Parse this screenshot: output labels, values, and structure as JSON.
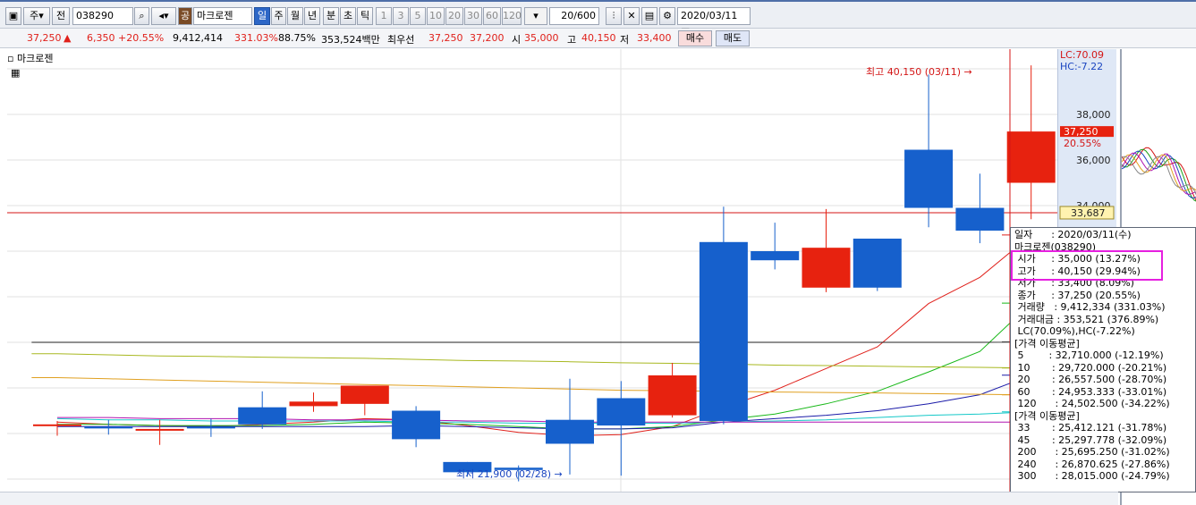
{
  "toolbar": {
    "market": "주",
    "scope": "전",
    "code": "038290",
    "name_badge": "공",
    "name": "마크로젠",
    "periods": [
      "일",
      "주",
      "월",
      "년",
      "분",
      "초",
      "틱"
    ],
    "minutes": [
      "1",
      "3",
      "5",
      "10",
      "20",
      "30",
      "60",
      "120"
    ],
    "count": "20/600",
    "date": "2020/03/11"
  },
  "quote": {
    "price": "37,250",
    "change": "6,350",
    "change_pct": "+20.55%",
    "volume": "9,412,414",
    "volume_ratio": "331.03%",
    "turnover": "88.75%",
    "amount": "353,524백만",
    "best_label": "최우선",
    "best_ask": "37,250",
    "best_bid": "37,200",
    "open_label": "시",
    "open": "35,000",
    "high_label": "고",
    "high": "40,150",
    "low_label": "저",
    "low": "33,400",
    "buy_label": "매수",
    "sell_label": "매도"
  },
  "chart": {
    "title": "마크로젠",
    "high_annotation": "최고 40,150 (03/11)",
    "low_annotation": "최저 21,900 (02/28)",
    "lc_label": "LC:70.09",
    "hc_label": "HC:-7.22",
    "price_tag": "37,250",
    "pct_tag": "20.55%",
    "line_tag": "33,687",
    "axis_labels": [
      "38,000",
      "36,000",
      "34,000"
    ]
  },
  "chart_data": {
    "type": "candlestick",
    "title": "마크로젠",
    "y_ticks": [
      34000,
      36000,
      38000
    ],
    "y_range": [
      20000,
      40350
    ],
    "candles": [
      {
        "o": 24350,
        "h": 24550,
        "l": 23900,
        "c": 24400
      },
      {
        "o": 24300,
        "h": 24600,
        "l": 23950,
        "c": 24250
      },
      {
        "o": 24200,
        "h": 24600,
        "l": 23500,
        "c": 24200
      },
      {
        "o": 24300,
        "h": 24650,
        "l": 23850,
        "c": 24250
      },
      {
        "o": 25150,
        "h": 25850,
        "l": 24200,
        "c": 24400
      },
      {
        "o": 25200,
        "h": 25800,
        "l": 24950,
        "c": 25400
      },
      {
        "o": 25300,
        "h": 26000,
        "l": 24800,
        "c": 26100
      },
      {
        "o": 25000,
        "h": 25200,
        "l": 23400,
        "c": 23750
      },
      {
        "o": 22750,
        "h": 22750,
        "l": 22100,
        "c": 22300
      },
      {
        "o": 22500,
        "h": 22600,
        "l": 21900,
        "c": 22400
      },
      {
        "o": 24600,
        "h": 26400,
        "l": 22200,
        "c": 23550
      },
      {
        "o": 25550,
        "h": 26300,
        "l": 22150,
        "c": 24350
      },
      {
        "o": 24800,
        "h": 27100,
        "l": 24700,
        "c": 26550
      },
      {
        "o": 32400,
        "h": 33950,
        "l": 24400,
        "c": 24550
      },
      {
        "o": 32000,
        "h": 33250,
        "l": 31200,
        "c": 31600
      },
      {
        "o": 30400,
        "h": 33850,
        "l": 30200,
        "c": 32150
      },
      {
        "o": 32550,
        "h": 32550,
        "l": 30250,
        "c": 30400
      },
      {
        "o": 36450,
        "h": 39750,
        "l": 33050,
        "c": 33900
      },
      {
        "o": 33900,
        "h": 35400,
        "l": 32350,
        "c": 32900
      },
      {
        "o": 35000,
        "h": 40150,
        "l": 33400,
        "c": 37250
      }
    ],
    "moving_averages": [
      {
        "name": "5",
        "color": "#e0211b",
        "values": [
          24500,
          24400,
          24350,
          24300,
          24400,
          24500,
          24650,
          24600,
          24350,
          24050,
          23900,
          23950,
          24300,
          25150,
          25900,
          26850,
          27800,
          29700,
          30850,
          32710
        ]
      },
      {
        "name": "10",
        "color": "#18b818",
        "values": [
          24400,
          24400,
          24350,
          24350,
          24350,
          24400,
          24500,
          24450,
          24400,
          24300,
          24200,
          24200,
          24300,
          24600,
          24850,
          25300,
          25850,
          26700,
          27600,
          29720
        ]
      },
      {
        "name": "20",
        "color": "#1a1aa8",
        "values": [
          24300,
          24300,
          24300,
          24300,
          24300,
          24300,
          24300,
          24350,
          24300,
          24250,
          24200,
          24200,
          24250,
          24500,
          24650,
          24800,
          25000,
          25300,
          25700,
          26557
        ]
      },
      {
        "name": "60",
        "color": "#14c8c8",
        "values": [
          24650,
          24600,
          24600,
          24550,
          24550,
          24550,
          24550,
          24500,
          24500,
          24450,
          24450,
          24450,
          24450,
          24500,
          24550,
          24600,
          24700,
          24800,
          24850,
          24953
        ]
      },
      {
        "name": "120",
        "color": "#b013b0",
        "values": [
          24700,
          24700,
          24650,
          24650,
          24650,
          24600,
          24600,
          24600,
          24550,
          24550,
          24500,
          24500,
          24500,
          24500,
          24500,
          24500,
          24500,
          24500,
          24500,
          24502
        ]
      },
      {
        "name": "200",
        "color": "#e0a020",
        "values": [
          26450,
          26400,
          26350,
          26300,
          26250,
          26200,
          26150,
          26100,
          26050,
          26000,
          25950,
          25900,
          25880,
          25850,
          25820,
          25800,
          25780,
          25750,
          25720,
          25695
        ]
      },
      {
        "name": "240",
        "color": "#a8b820",
        "values": [
          27500,
          27450,
          27400,
          27380,
          27350,
          27320,
          27300,
          27250,
          27200,
          27180,
          27150,
          27100,
          27080,
          27050,
          27000,
          26980,
          26950,
          26920,
          26900,
          26870
        ]
      },
      {
        "name": "300",
        "color": "#222222",
        "values": [
          28000,
          28000,
          28000,
          28000,
          28000,
          28000,
          28000,
          28000,
          28000,
          28000,
          28000,
          28000,
          28000,
          28000,
          28000,
          28000,
          28000,
          28000,
          28000,
          28015
        ]
      }
    ],
    "horizontal_line": 33687
  },
  "info": {
    "rows": [
      "일자      : 2020/03/11(수)",
      "마크로젠(038290)",
      " 시가     : 35,000 (13.27%)",
      " 고가     : 40,150 (29.94%)",
      " 저가     : 33,400 (8.09%)",
      " 종가     : 37,250 (20.55%)",
      " 거래량   : 9,412,334 (331.03%)",
      " 거래대금 : 353,521 (376.89%)",
      " LC(70.09%),HC(-7.22%)",
      "[가격 이동평균]",
      " 5        : 32,710.000 (-12.19%)",
      " 10       : 29,720.000 (-20.21%)",
      " 20       : 26,557.500 (-28.70%)",
      " 60       : 24,953.333 (-33.01%)",
      " 120      : 24,502.500 (-34.22%)",
      "[가격 이동평균]",
      " 33       : 25,412.121 (-31.78%)",
      " 45       : 25,297.778 (-32.09%)",
      " 200      : 25,695.250 (-31.02%)",
      " 240      : 26,870.625 (-27.86%)",
      " 300      : 28,015.000 (-24.79%)"
    ]
  }
}
